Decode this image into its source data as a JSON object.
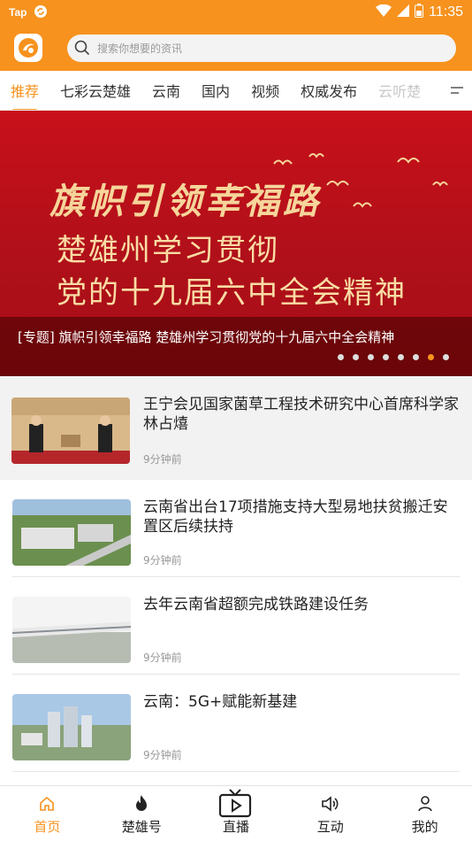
{
  "status_bar": {
    "app_badge": "Tap",
    "time": "11:35"
  },
  "search": {
    "placeholder": "搜索你想要的资讯"
  },
  "tabs": [
    {
      "label": "推荐",
      "active": true
    },
    {
      "label": "七彩云楚雄"
    },
    {
      "label": "云南"
    },
    {
      "label": "国内"
    },
    {
      "label": "视频"
    },
    {
      "label": "权威发布"
    },
    {
      "label": "云听楚"
    }
  ],
  "banner": {
    "title_line1": "旗帜引领幸福路",
    "title_line2": "楚雄州学习贯彻",
    "title_line3": "党的十九届六中全会精神",
    "caption": "[专题] 旗帜引领幸福路  楚雄州学习贯彻党的十九届六中全会精神",
    "dot_count": 8,
    "active_dot": 7
  },
  "news": [
    {
      "title": "王宁会见国家菌草工程技术研究中心首席科学家林占熺",
      "time": "9分钟前"
    },
    {
      "title": "云南省出台17项措施支持大型易地扶贫搬迁安置区后续扶持",
      "time": "9分钟前"
    },
    {
      "title": "去年云南省超额完成铁路建设任务",
      "time": "9分钟前"
    },
    {
      "title": "云南：5G+赋能新基建",
      "time": "9分钟前"
    }
  ],
  "bottom_nav": [
    {
      "label": "首页",
      "icon": "home-icon",
      "active": true
    },
    {
      "label": "楚雄号",
      "icon": "flame-icon"
    },
    {
      "label": "直播",
      "icon": "tv-icon"
    },
    {
      "label": "互动",
      "icon": "speaker-icon"
    },
    {
      "label": "我的",
      "icon": "user-icon"
    }
  ],
  "colors": {
    "accent": "#f7921e",
    "banner_red": "#c8101a"
  }
}
